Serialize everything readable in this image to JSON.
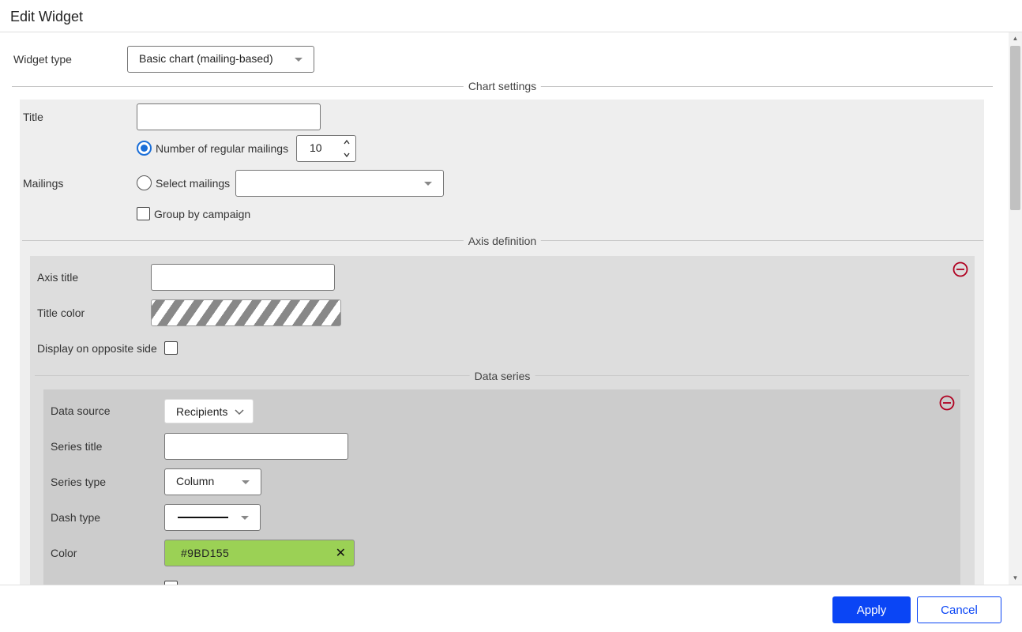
{
  "dialog": {
    "title": "Edit Widget"
  },
  "widget_type": {
    "label": "Widget type",
    "value": "Basic chart (mailing-based)"
  },
  "chart_settings": {
    "legend": "Chart settings",
    "title_label": "Title",
    "title_value": "",
    "mailings_label": "Mailings",
    "regular_mailings_label": "Number of regular mailings",
    "regular_mailings_count": "10",
    "select_mailings_label": "Select mailings",
    "select_mailings_value": "",
    "group_by_campaign_label": "Group by campaign"
  },
  "axis_definition": {
    "legend": "Axis definition",
    "axis_title_label": "Axis title",
    "axis_title_value": "",
    "title_color_label": "Title color",
    "opposite_side_label": "Display on opposite side"
  },
  "data_series": {
    "legend": "Data series",
    "data_source_label": "Data source",
    "data_source_value": "Recipients",
    "series_title_label": "Series title",
    "series_title_value": "",
    "series_type_label": "Series type",
    "series_type_value": "Column",
    "dash_type_label": "Dash type",
    "color_label": "Color",
    "color_value": "#9BD155"
  },
  "colors": {
    "accent": "#0a45f5",
    "radio_selected": "#1a6ed8",
    "remove": "#b00020",
    "series_color": "#9BD155"
  },
  "footer": {
    "apply_label": "Apply",
    "cancel_label": "Cancel"
  }
}
